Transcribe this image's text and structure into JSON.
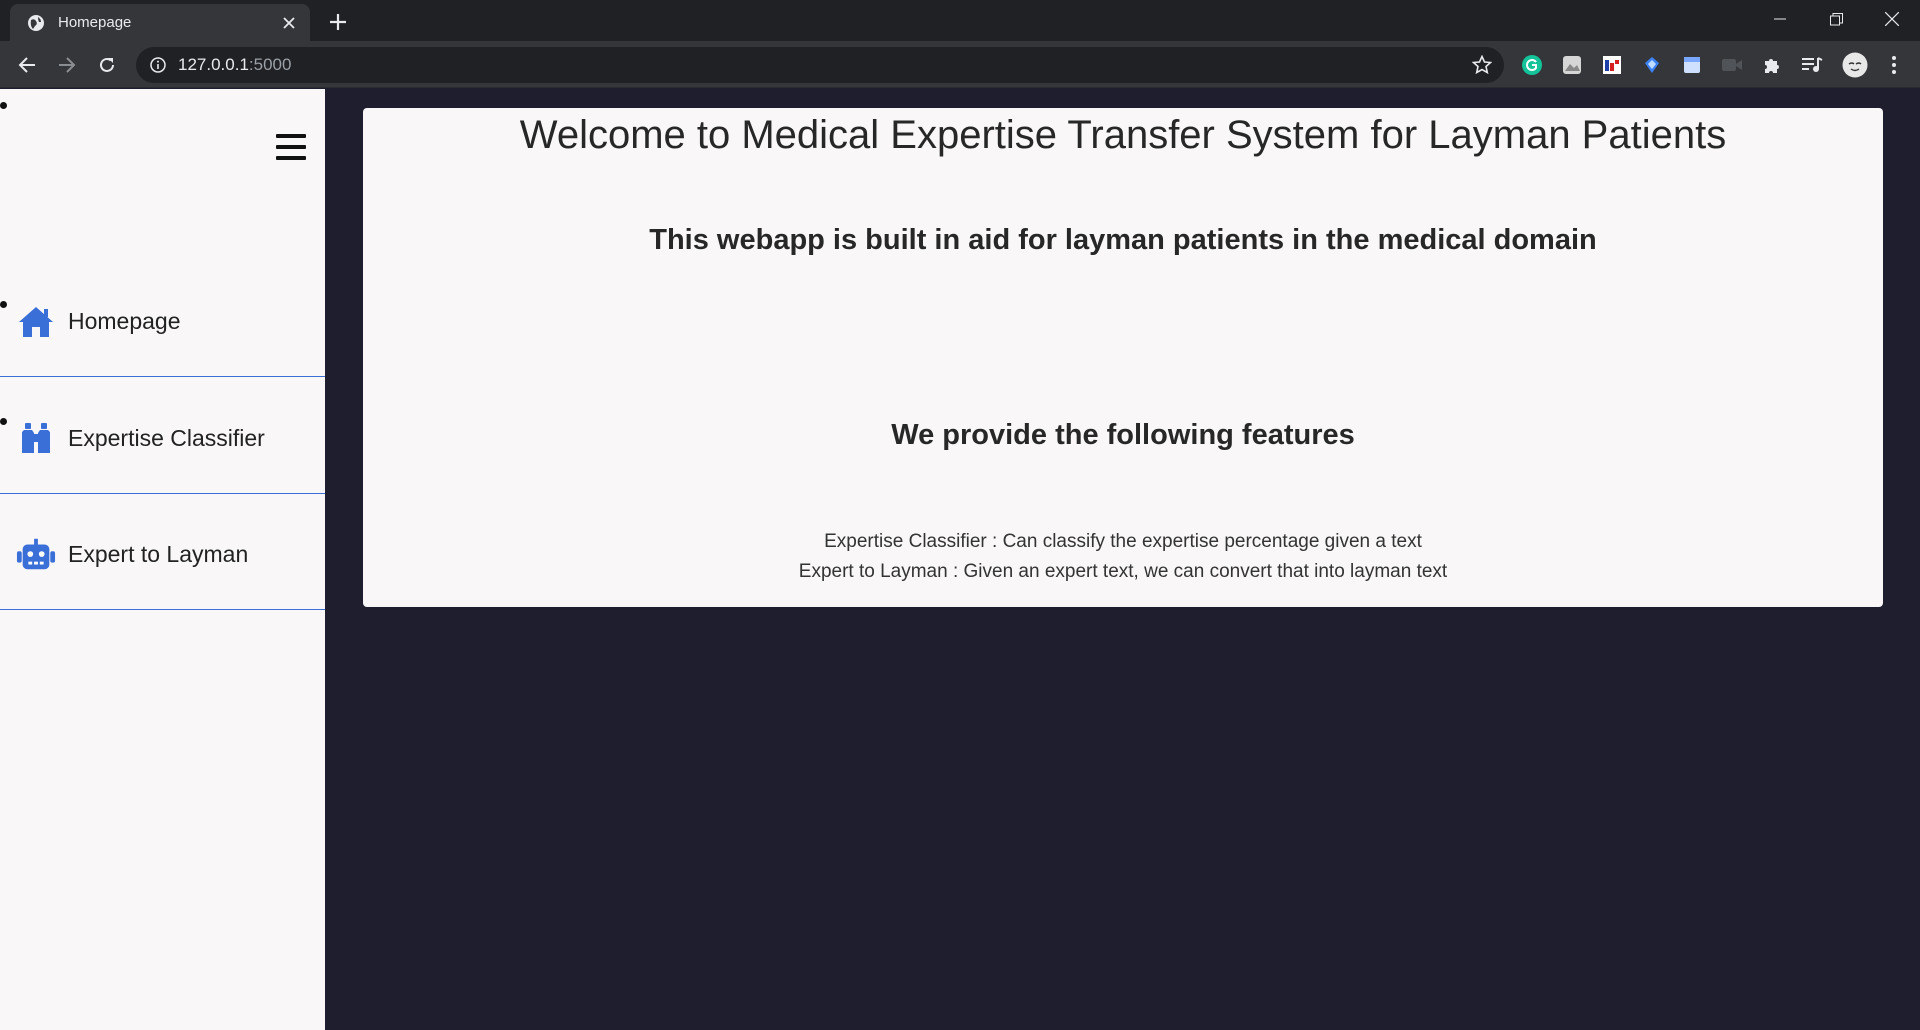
{
  "browser": {
    "tab_title": "Homepage",
    "url_host": "127.0.0.1",
    "url_port": ":5000"
  },
  "sidebar": {
    "items": [
      {
        "label": "Homepage",
        "icon": "home-icon"
      },
      {
        "label": "Expertise Classifier",
        "icon": "binoculars-icon"
      },
      {
        "label": "Expert to Layman",
        "icon": "robot-icon"
      }
    ]
  },
  "main": {
    "title": "Welcome to Medical Expertise Transfer System for Layman Patients",
    "subtitle": "This webapp is built in aid for layman patients in the medical domain",
    "features_heading": "We provide the following features",
    "features": [
      "Expertise Classifier : Can classify the expertise percentage given a text",
      "Expert to Layman : Given an expert text, we can convert that into layman text"
    ]
  },
  "colors": {
    "accent": "#3b6fd8",
    "page_bg": "#1e1e2e",
    "panel_bg": "#f9f7f8"
  }
}
